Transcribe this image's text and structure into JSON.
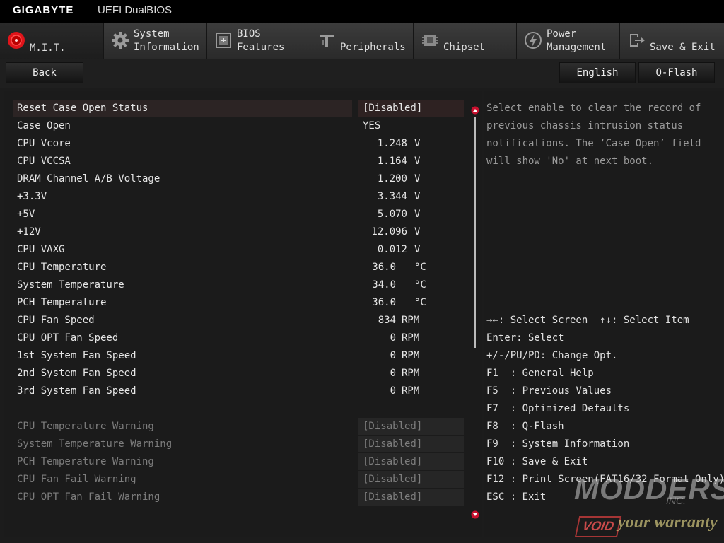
{
  "brand": "GIGABYTE",
  "product": "UEFI DualBIOS",
  "tabs": [
    {
      "line1": "",
      "line2": "M.I.T.",
      "icon": "mit-icon"
    },
    {
      "line1": "System",
      "line2": "Information",
      "icon": "gear-icon"
    },
    {
      "line1": "BIOS",
      "line2": "Features",
      "icon": "bios-features-icon"
    },
    {
      "line1": "",
      "line2": "Peripherals",
      "icon": "peripherals-icon"
    },
    {
      "line1": "",
      "line2": "Chipset",
      "icon": "chipset-icon"
    },
    {
      "line1": "Power",
      "line2": "Management",
      "icon": "power-icon"
    },
    {
      "line1": "",
      "line2": "Save & Exit",
      "icon": "exit-icon"
    }
  ],
  "buttons": {
    "back": "Back",
    "language": "English",
    "qflash": "Q-Flash"
  },
  "items": [
    {
      "label": "Reset Case Open Status",
      "value": "[Disabled]"
    },
    {
      "label": "Case Open",
      "value": "YES"
    },
    {
      "label": "CPU Vcore",
      "num": "1.248",
      "unit": "V"
    },
    {
      "label": "CPU VCCSA",
      "num": "1.164",
      "unit": "V"
    },
    {
      "label": "DRAM Channel A/B Voltage",
      "num": "1.200",
      "unit": "V"
    },
    {
      "label": "+3.3V",
      "num": "3.344",
      "unit": "V"
    },
    {
      "label": "+5V",
      "num": "5.070",
      "unit": "V"
    },
    {
      "label": "+12V",
      "num": "12.096",
      "unit": "V"
    },
    {
      "label": "CPU VAXG",
      "num": "0.012",
      "unit": "V"
    },
    {
      "label": "CPU Temperature",
      "num": "36.0",
      "unit": "°C"
    },
    {
      "label": "System Temperature",
      "num": "34.0",
      "unit": "°C"
    },
    {
      "label": "PCH Temperature",
      "num": "36.0",
      "unit": "°C"
    },
    {
      "label": "CPU Fan Speed",
      "num": "834",
      "unit": "RPM"
    },
    {
      "label": "CPU OPT Fan Speed",
      "num": "0",
      "unit": "RPM"
    },
    {
      "label": "1st System Fan Speed",
      "num": "0",
      "unit": "RPM"
    },
    {
      "label": "2nd System Fan Speed",
      "num": "0",
      "unit": "RPM"
    },
    {
      "label": "3rd System Fan Speed",
      "num": "0",
      "unit": "RPM"
    }
  ],
  "warnings": [
    {
      "label": "CPU Temperature Warning",
      "value": "[Disabled]"
    },
    {
      "label": "System Temperature Warning",
      "value": "[Disabled]"
    },
    {
      "label": "PCH Temperature Warning",
      "value": "[Disabled]"
    },
    {
      "label": "CPU Fan Fail Warning",
      "value": "[Disabled]"
    },
    {
      "label": "CPU OPT Fan Fail Warning",
      "value": "[Disabled]"
    }
  ],
  "help": [
    "Select enable to clear the record of",
    "previous chassis intrusion status",
    "notifications. The ‘Case Open’ field",
    "will show 'No' at next boot."
  ],
  "keys": [
    "→←: Select Screen  ↑↓: Select Item",
    "Enter: Select",
    "+/-/PU/PD: Change Opt.",
    "F1  : General Help",
    "F5  : Previous Values",
    "F7  : Optimized Defaults",
    "F8  : Q-Flash",
    "F9  : System Information",
    "F10 : Save & Exit",
    "F12 : Print Screen(FAT16/32 Format Only)",
    "ESC : Exit"
  ],
  "watermark": {
    "line1": "MODDERS",
    "line2": "INC.",
    "void": "VOID",
    "tagline": "your warranty"
  },
  "colors": {
    "active_tab_icon": "#e0141a",
    "selected_row": "#2c2424"
  }
}
